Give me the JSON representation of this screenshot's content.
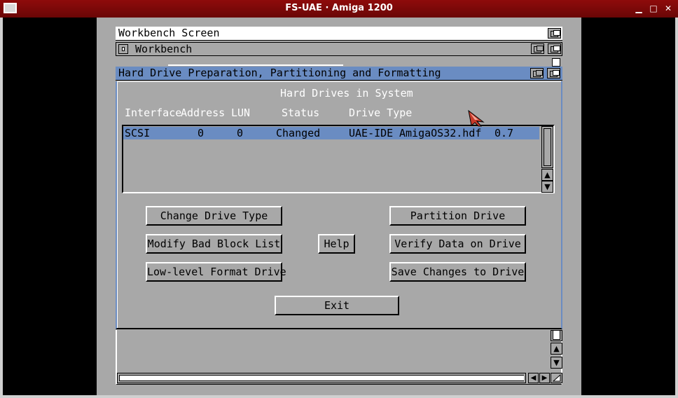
{
  "window": {
    "title": "FS-UAE · Amiga 1200"
  },
  "controls": {
    "minimize_glyph": "▁",
    "maximize_glyph": "□",
    "close_glyph": "✕"
  },
  "screen": {
    "title": "Workbench Screen"
  },
  "workbench": {
    "title": "Workbench"
  },
  "hdtoolbox": {
    "title": "Hard Drive Preparation, Partitioning and Formatting",
    "heading": "Hard Drives in System",
    "columns": {
      "interface": "Interface",
      "address": "Address",
      "lun": "LUN",
      "status": "Status",
      "drive_type": "Drive Type"
    },
    "drives": [
      {
        "interface": "SCSI",
        "address": "0",
        "lun": "0",
        "status": "Changed",
        "drive_type": "UAE-IDE",
        "file": "AmigaOS32.hdf",
        "size": "0.7"
      }
    ],
    "buttons": {
      "change_drive_type": "Change Drive Type",
      "modify_bad_block": "Modify Bad Block List",
      "low_level_format": "Low-level Format Drive",
      "help": "Help",
      "partition": "Partition Drive",
      "verify": "Verify Data on Drive",
      "save": "Save Changes to Drive",
      "exit": "Exit"
    }
  },
  "icons": {
    "up": "▲",
    "down": "▼",
    "left": "◀",
    "right": "▶"
  },
  "colors": {
    "titlebar": "#7e0808",
    "amiga_grey": "#a8a8a8",
    "amiga_blue": "#6a8cc2",
    "selection": "#6a8cc2"
  }
}
